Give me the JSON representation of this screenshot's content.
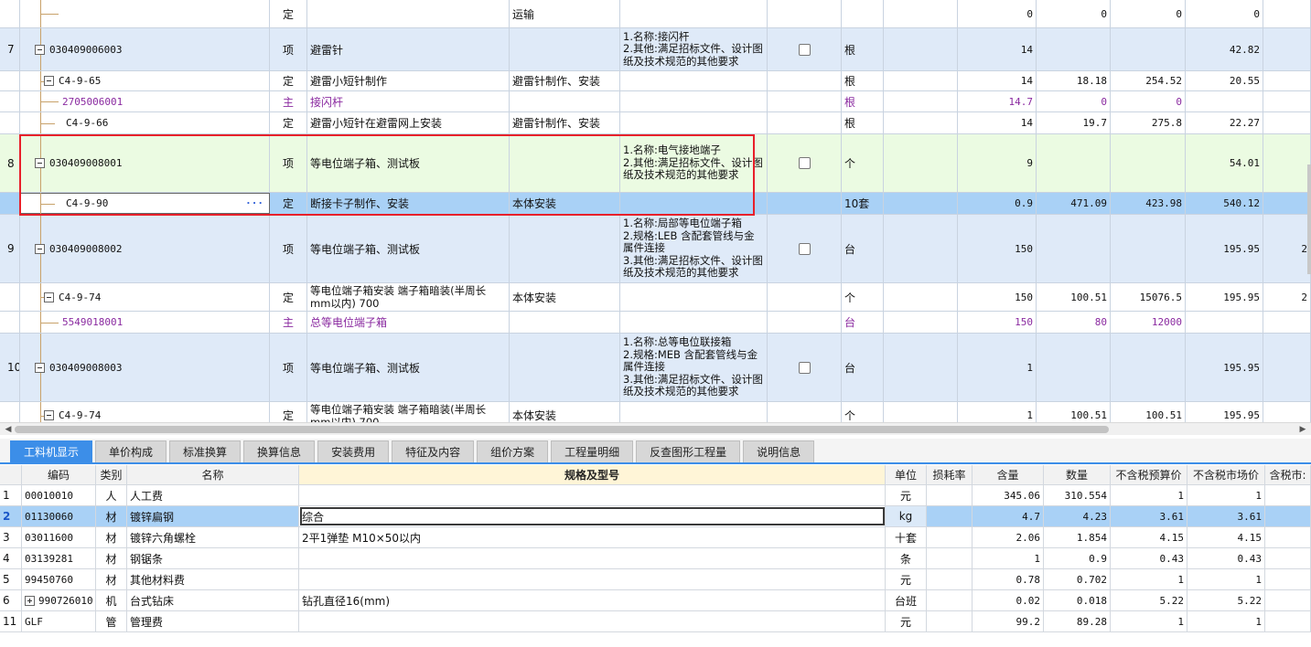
{
  "top_rows": [
    {
      "kind": "ding",
      "idx": "",
      "code": "",
      "type": "定",
      "name": "",
      "feature": "运输",
      "desc": "",
      "unit": "",
      "qty": "0",
      "p1": "0",
      "p2": "0",
      "p3": "0"
    },
    {
      "kind": "xiang",
      "idx": "7",
      "code": "030409006003",
      "type": "项",
      "name": "避雷针",
      "feature": "",
      "desc": "1.名称:接闪杆\n2.其他:满足招标文件、设计图纸及技术规范的其他要求",
      "unit": "根",
      "qty": "14",
      "p1": "",
      "p2": "",
      "p3": "42.82"
    },
    {
      "kind": "ding",
      "idx": "",
      "code": "C4-9-65",
      "type": "定",
      "name": "避雷小短针制作",
      "feature": "避雷针制作、安装",
      "desc": "",
      "unit": "根",
      "qty": "14",
      "p1": "18.18",
      "p2": "254.52",
      "p3": "20.55"
    },
    {
      "kind": "zhu",
      "idx": "",
      "code": "2705006001",
      "type": "主",
      "name": "接闪杆",
      "feature": "",
      "desc": "",
      "unit": "根",
      "qty": "14.7",
      "p1": "0",
      "p2": "0",
      "p3": ""
    },
    {
      "kind": "ding",
      "idx": "",
      "code": "C4-9-66",
      "type": "定",
      "name": "避雷小短针在避雷网上安装",
      "feature": "避雷针制作、安装",
      "desc": "",
      "unit": "根",
      "qty": "14",
      "p1": "19.7",
      "p2": "275.8",
      "p3": "22.27"
    },
    {
      "kind": "green",
      "idx": "8",
      "code": "030409008001",
      "type": "项",
      "name": "等电位端子箱、测试板",
      "feature": "",
      "desc": "1.名称:电气接地端子\n2.其他:满足招标文件、设计图纸及技术规范的其他要求",
      "unit": "个",
      "qty": "9",
      "p1": "",
      "p2": "",
      "p3": "54.01"
    },
    {
      "kind": "selected",
      "idx": "",
      "code": "C4-9-90",
      "type": "定",
      "name": "断接卡子制作、安装",
      "feature": "本体安装",
      "desc": "",
      "unit": "10套",
      "qty": "0.9",
      "p1": "471.09",
      "p2": "423.98",
      "p3": "540.12"
    },
    {
      "kind": "xiang",
      "idx": "9",
      "code": "030409008002",
      "type": "项",
      "name": "等电位端子箱、测试板",
      "feature": "",
      "desc": "1.名称:局部等电位端子箱\n2.规格:LEB 含配套管线与金属件连接\n3.其他:满足招标文件、设计图纸及技术规范的其他要求",
      "unit": "台",
      "qty": "150",
      "p1": "",
      "p2": "",
      "p3": "195.95",
      "p4": "2"
    },
    {
      "kind": "ding",
      "idx": "",
      "code": "C4-9-74",
      "type": "定",
      "name": "等电位端子箱安装 端子箱暗装(半周长mm以内) 700",
      "feature": "本体安装",
      "desc": "",
      "unit": "个",
      "qty": "150",
      "p1": "100.51",
      "p2": "15076.5",
      "p3": "195.95",
      "p4": "2"
    },
    {
      "kind": "zhu",
      "idx": "",
      "code": "5549018001",
      "type": "主",
      "name": "总等电位端子箱",
      "feature": "",
      "desc": "",
      "unit": "台",
      "qty": "150",
      "p1": "80",
      "p2": "12000",
      "p3": ""
    },
    {
      "kind": "xiang",
      "idx": "10",
      "code": "030409008003",
      "type": "项",
      "name": "等电位端子箱、测试板",
      "feature": "",
      "desc": "1.名称:总等电位联接箱\n2.规格:MEB 含配套管线与金属件连接\n3.其他:满足招标文件、设计图纸及技术规范的其他要求",
      "unit": "台",
      "qty": "1",
      "p1": "",
      "p2": "",
      "p3": "195.95"
    },
    {
      "kind": "ding",
      "idx": "",
      "code": "C4-9-74",
      "type": "定",
      "name": "等电位端子箱安装 端子箱暗装(半周长mm以内) 700",
      "feature": "本体安装",
      "desc": "",
      "unit": "个",
      "qty": "1",
      "p1": "100.51",
      "p2": "100.51",
      "p3": "195.95"
    }
  ],
  "tabs": [
    "工料机显示",
    "单价构成",
    "标准换算",
    "换算信息",
    "安装费用",
    "特征及内容",
    "组价方案",
    "工程量明细",
    "反查图形工程量",
    "说明信息"
  ],
  "bottom_headers": [
    "",
    "编码",
    "类别",
    "名称",
    "规格及型号",
    "单位",
    "损耗率",
    "含量",
    "数量",
    "不含税预算价",
    "不含税市场价",
    "含税市:"
  ],
  "bottom_rows": [
    {
      "idx": "1",
      "code": "00010010",
      "cat": "人",
      "name": "人工费",
      "spec": "",
      "unit": "元",
      "loss": "",
      "content": "345.06",
      "qty": "310.554",
      "p1": "1",
      "p2": "1"
    },
    {
      "idx": "2",
      "code": "01130060",
      "cat": "材",
      "name": "镀锌扁钢",
      "spec": "综合",
      "unit": "kg",
      "loss": "",
      "content": "4.7",
      "qty": "4.23",
      "p1": "3.61",
      "p2": "3.61"
    },
    {
      "idx": "3",
      "code": "03011600",
      "cat": "材",
      "name": "镀锌六角螺栓",
      "spec": "2平1弹垫 M10×50以内",
      "unit": "十套",
      "loss": "",
      "content": "2.06",
      "qty": "1.854",
      "p1": "4.15",
      "p2": "4.15"
    },
    {
      "idx": "4",
      "code": "03139281",
      "cat": "材",
      "name": "钢锯条",
      "spec": "",
      "unit": "条",
      "loss": "",
      "content": "1",
      "qty": "0.9",
      "p1": "0.43",
      "p2": "0.43"
    },
    {
      "idx": "5",
      "code": "99450760",
      "cat": "材",
      "name": "其他材料费",
      "spec": "",
      "unit": "元",
      "loss": "",
      "content": "0.78",
      "qty": "0.702",
      "p1": "1",
      "p2": "1"
    },
    {
      "idx": "6",
      "code": "990726010",
      "cat": "机",
      "name": "台式钻床",
      "spec": "钻孔直径16(mm)",
      "unit": "台班",
      "loss": "",
      "content": "0.02",
      "qty": "0.018",
      "p1": "5.22",
      "p2": "5.22"
    },
    {
      "idx": "11",
      "code": "GLF",
      "cat": "管",
      "name": "管理费",
      "spec": "",
      "unit": "元",
      "loss": "",
      "content": "99.2",
      "qty": "89.28",
      "p1": "1",
      "p2": "1"
    }
  ],
  "icons": {
    "expand": "minus-square-icon",
    "collapse": "plus-square-icon",
    "more": "ellipsis-icon",
    "scroll_left": "arrow-left-icon",
    "scroll_right": "arrow-right-icon"
  },
  "colors": {
    "selected_row": "#a9d1f6",
    "item_row": "#dfeaf8",
    "highlight_row": "#ebfbe2",
    "main_material_text": "#8a2aa0",
    "active_tab": "#3c8ee8",
    "annotation_box": "#e8202a"
  }
}
